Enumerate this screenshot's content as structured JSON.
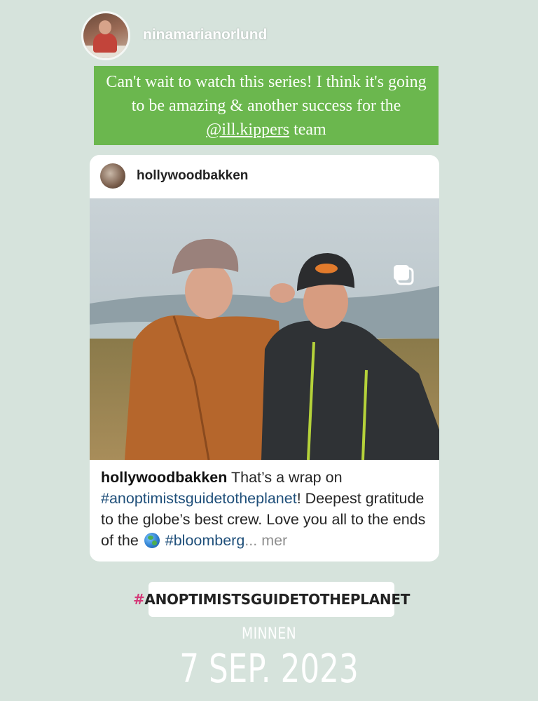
{
  "story": {
    "author_username": "ninamarianorlund",
    "caption_text": "Can't wait to watch this series! I think it's going to be amazing & another success for the ",
    "caption_mention": "@ill.kippers",
    "caption_tail": " team"
  },
  "shared_post": {
    "username": "hollywoodbakken",
    "caption_owner": "hollywoodbakken",
    "caption_part1": " That’s a wrap on ",
    "caption_hashtag1": "#anoptimistsguidetotheplanet",
    "caption_part2": "! Deepest gratitude to the globe’s best crew. Love you all to the ends of the ",
    "caption_hashtag2": "#bloomberg",
    "caption_more": "... mer",
    "icons": {
      "multi_photo": "carousel-icon",
      "globe": "globe-emoji-icon"
    }
  },
  "hashtag_sticker": {
    "hash": "#",
    "text": "ANOPTIMISTSGUIDETOTHEPLANET"
  },
  "memory": {
    "label": "MINNEN",
    "date": "7 SEP. 2023"
  },
  "colors": {
    "background": "#d6e3dc",
    "caption_bg": "#6bb74e",
    "hashtag_pink": "#d43a78",
    "link_blue": "#1f4f7a"
  }
}
